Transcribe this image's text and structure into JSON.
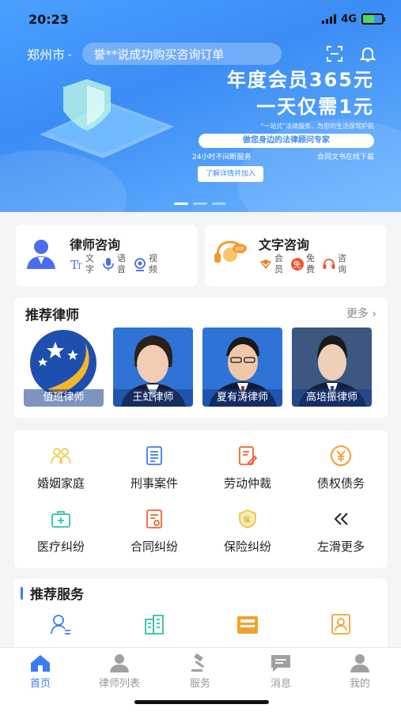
{
  "status": {
    "time": "20:23",
    "network": "4G"
  },
  "header": {
    "city": "郑州市",
    "ticker": "誉**说成功购买咨询订单",
    "icons": [
      "scan-icon",
      "bell-icon"
    ]
  },
  "banner": {
    "line1": "年度会员365元",
    "line2": "一天仅需1元",
    "slogan": "\"一站式\"法律服务，为您的生活保驾护航",
    "tag": "做您身边的法律顾问专家",
    "left_note": "24小时不间断服务",
    "right_note": "合同文书在线下载",
    "cta": "了解详情并加入"
  },
  "consult": [
    {
      "title": "律师咨询",
      "icon": "lawyer-avatar-icon",
      "subs": [
        {
          "label": "文字",
          "icon": "text-icon"
        },
        {
          "label": "语音",
          "icon": "mic-icon"
        },
        {
          "label": "视频",
          "icon": "video-icon"
        }
      ]
    },
    {
      "title": "文字咨询",
      "icon": "vip-headset-icon",
      "subs": [
        {
          "label": "会员",
          "icon": "member-icon"
        },
        {
          "label": "免费",
          "icon": "free-icon"
        },
        {
          "label": "咨询",
          "icon": "headset-icon"
        }
      ]
    }
  ],
  "lawyers": {
    "title": "推荐律师",
    "more": "更多",
    "items": [
      {
        "name": "值班律师"
      },
      {
        "name": "王虹律师"
      },
      {
        "name": "夏有涛律师"
      },
      {
        "name": "高培振律师"
      }
    ]
  },
  "categories": [
    {
      "label": "婚姻家庭",
      "icon": "family-icon"
    },
    {
      "label": "刑事案件",
      "icon": "document-icon"
    },
    {
      "label": "劳动仲裁",
      "icon": "edit-doc-icon"
    },
    {
      "label": "债权债务",
      "icon": "yen-icon"
    },
    {
      "label": "医疗纠纷",
      "icon": "medical-icon"
    },
    {
      "label": "合同纠纷",
      "icon": "contract-icon"
    },
    {
      "label": "保险纠纷",
      "icon": "shield-icon"
    },
    {
      "label": "左滑更多",
      "icon": "double-chevron-left-icon"
    }
  ],
  "services": {
    "title": "推荐服务",
    "icons": [
      "person-list-icon",
      "building-icon",
      "inbox-icon",
      "id-card-icon"
    ]
  },
  "tabs": [
    {
      "label": "首页",
      "icon": "home-icon",
      "active": true
    },
    {
      "label": "律师列表",
      "icon": "person-icon"
    },
    {
      "label": "服务",
      "icon": "gavel-icon"
    },
    {
      "label": "消息",
      "icon": "message-icon"
    },
    {
      "label": "我的",
      "icon": "profile-icon"
    }
  ],
  "colors": {
    "accent": "#3b7cf5",
    "banner": "#3b8cf5"
  }
}
